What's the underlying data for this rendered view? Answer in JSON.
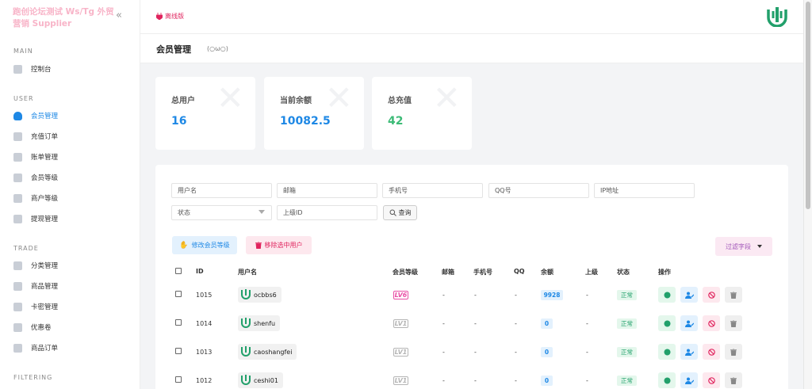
{
  "sidebar": {
    "brand": "跑创论坛测试 Ws/Tg 外贸营销 Supplier",
    "sections": [
      {
        "title": "MAIN",
        "items": [
          {
            "label": "控制台"
          }
        ]
      },
      {
        "title": "USER",
        "items": [
          {
            "label": "会员管理"
          },
          {
            "label": "充值订单"
          },
          {
            "label": "账单管理"
          },
          {
            "label": "会员等级"
          },
          {
            "label": "商户等级"
          },
          {
            "label": "提现管理"
          }
        ]
      },
      {
        "title": "TRADE",
        "items": [
          {
            "label": "分类管理"
          },
          {
            "label": "商品管理"
          },
          {
            "label": "卡密管理"
          },
          {
            "label": "优惠卷"
          },
          {
            "label": "商品订单"
          }
        ]
      },
      {
        "title": "FILTERING",
        "items": []
      }
    ]
  },
  "topbar": {
    "status": "离线版"
  },
  "page": {
    "title": "会员管理",
    "face": "(○ω○)"
  },
  "stats": [
    {
      "label": "总用户",
      "value": "16",
      "color": "#1e88e5"
    },
    {
      "label": "当前余额",
      "value": "10082.5",
      "color": "#1e88e5"
    },
    {
      "label": "总充值",
      "value": "42",
      "color": "#3dbb77"
    }
  ],
  "filters": {
    "username": "用户名",
    "email": "邮箱",
    "phone": "手机号",
    "qq": "QQ号",
    "ip": "IP地址",
    "status": "状态",
    "parent_id": "上级ID",
    "query": "查询"
  },
  "actions": {
    "edit_level": "修改会员等级",
    "delete_selected": "移除选中用户",
    "filter_fields": "过滤字段"
  },
  "table": {
    "headers": {
      "id": "ID",
      "username": "用户名",
      "level": "会员等级",
      "email": "邮箱",
      "phone": "手机号",
      "qq": "QQ",
      "balance": "余额",
      "parent": "上级",
      "status": "状态",
      "ops": "操作"
    },
    "rows": [
      {
        "id": "1015",
        "username": "ocbbs6",
        "level": "LV6",
        "email": "-",
        "phone": "-",
        "qq": "-",
        "balance": "9928",
        "parent": "-",
        "status": "正常"
      },
      {
        "id": "1014",
        "username": "shenfu",
        "level": "LV1",
        "email": "-",
        "phone": "-",
        "qq": "-",
        "balance": "0",
        "parent": "-",
        "status": "正常"
      },
      {
        "id": "1013",
        "username": "caoshangfei",
        "level": "LV1",
        "email": "-",
        "phone": "-",
        "qq": "-",
        "balance": "0",
        "parent": "-",
        "status": "正常"
      },
      {
        "id": "1012",
        "username": "ceshi01",
        "level": "LV1",
        "email": "-",
        "phone": "-",
        "qq": "-",
        "balance": "0",
        "parent": "-",
        "status": "正常"
      }
    ]
  },
  "colors": {
    "accent": "#1e88e5",
    "success": "#22a06b",
    "danger": "#e0245e",
    "lv6": "#e94fa6",
    "lv1": "#b5b5b5"
  }
}
